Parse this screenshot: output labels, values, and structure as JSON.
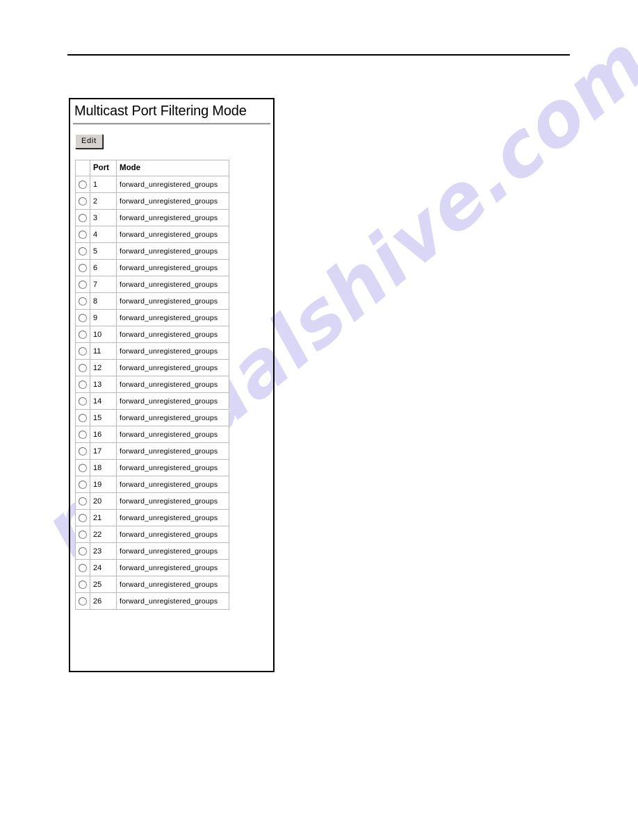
{
  "page": {
    "background_color": "#ffffff",
    "rule_color": "#000000"
  },
  "watermark": {
    "text": "manualshive.com",
    "color": "#cbc9f2"
  },
  "panel": {
    "title": "Multicast Port Filtering Mode",
    "border_color": "#000000",
    "edit_button_label": "Edit"
  },
  "table": {
    "headers": {
      "select": "",
      "port": "Port",
      "mode": "Mode"
    },
    "rows": [
      {
        "port": "1",
        "mode": "forward_unregistered_groups"
      },
      {
        "port": "2",
        "mode": "forward_unregistered_groups"
      },
      {
        "port": "3",
        "mode": "forward_unregistered_groups"
      },
      {
        "port": "4",
        "mode": "forward_unregistered_groups"
      },
      {
        "port": "5",
        "mode": "forward_unregistered_groups"
      },
      {
        "port": "6",
        "mode": "forward_unregistered_groups"
      },
      {
        "port": "7",
        "mode": "forward_unregistered_groups"
      },
      {
        "port": "8",
        "mode": "forward_unregistered_groups"
      },
      {
        "port": "9",
        "mode": "forward_unregistered_groups"
      },
      {
        "port": "10",
        "mode": "forward_unregistered_groups"
      },
      {
        "port": "11",
        "mode": "forward_unregistered_groups"
      },
      {
        "port": "12",
        "mode": "forward_unregistered_groups"
      },
      {
        "port": "13",
        "mode": "forward_unregistered_groups"
      },
      {
        "port": "14",
        "mode": "forward_unregistered_groups"
      },
      {
        "port": "15",
        "mode": "forward_unregistered_groups"
      },
      {
        "port": "16",
        "mode": "forward_unregistered_groups"
      },
      {
        "port": "17",
        "mode": "forward_unregistered_groups"
      },
      {
        "port": "18",
        "mode": "forward_unregistered_groups"
      },
      {
        "port": "19",
        "mode": "forward_unregistered_groups"
      },
      {
        "port": "20",
        "mode": "forward_unregistered_groups"
      },
      {
        "port": "21",
        "mode": "forward_unregistered_groups"
      },
      {
        "port": "22",
        "mode": "forward_unregistered_groups"
      },
      {
        "port": "23",
        "mode": "forward_unregistered_groups"
      },
      {
        "port": "24",
        "mode": "forward_unregistered_groups"
      },
      {
        "port": "25",
        "mode": "forward_unregistered_groups"
      },
      {
        "port": "26",
        "mode": "forward_unregistered_groups"
      }
    ]
  }
}
